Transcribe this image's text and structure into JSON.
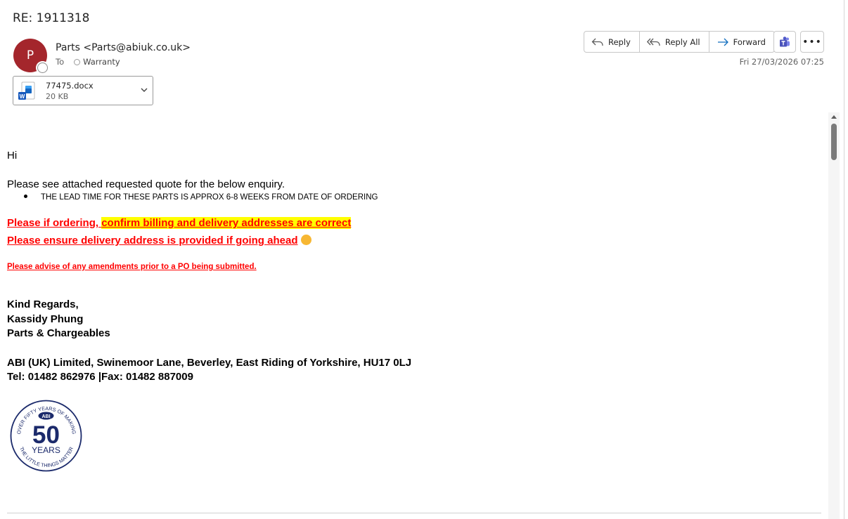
{
  "subject": "RE: 1911318",
  "sender": {
    "initial": "P",
    "display": "Parts <Parts@abiuk.co.uk>",
    "avatar_color": "#a4262c"
  },
  "to": {
    "label": "To",
    "recipient": "Warranty"
  },
  "date": "Fri 27/03/2026 07:25",
  "actions": {
    "reply": "Reply",
    "reply_all": "Reply All",
    "forward": "Forward"
  },
  "attachment": {
    "name": "77475.docx",
    "size": "20 KB"
  },
  "body": {
    "greeting": "Hi",
    "intro": "Please see attached requested quote for the below enquiry.",
    "bullet": "THE LEAD TIME FOR THESE PARTS IS APPROX 6-8 WEEKS FROM DATE OF ORDERING",
    "warn1_a": "Please if ordering, ",
    "warn1_b": "confirm billing and delivery addresses are correct",
    "warn2": "Please ensure delivery address is provided if going ahead",
    "warn3": "Please advise of any amendments prior to a PO being submitted.",
    "signoff": "Kind Regards,",
    "name": "Kassidy Phung",
    "dept": "Parts & Chargeables",
    "address": "ABI (UK) Limited, Swinemoor Lane, Beverley, East Riding of Yorkshire, HU17 0LJ",
    "phone": "Tel: 01482 862976 |Fax: 01482 887009"
  },
  "logo": {
    "top_text": "OVER FIFTY YEARS OF MAKING",
    "bottom_text": "THE LITTLE THINGS MATTER",
    "brand": "ABI",
    "number": "50",
    "years": "YEARS",
    "color": "#1b2a6b"
  },
  "colors": {
    "warning_red": "#ff0000",
    "highlight": "#ffff00",
    "accent": "#0f6cbd"
  }
}
